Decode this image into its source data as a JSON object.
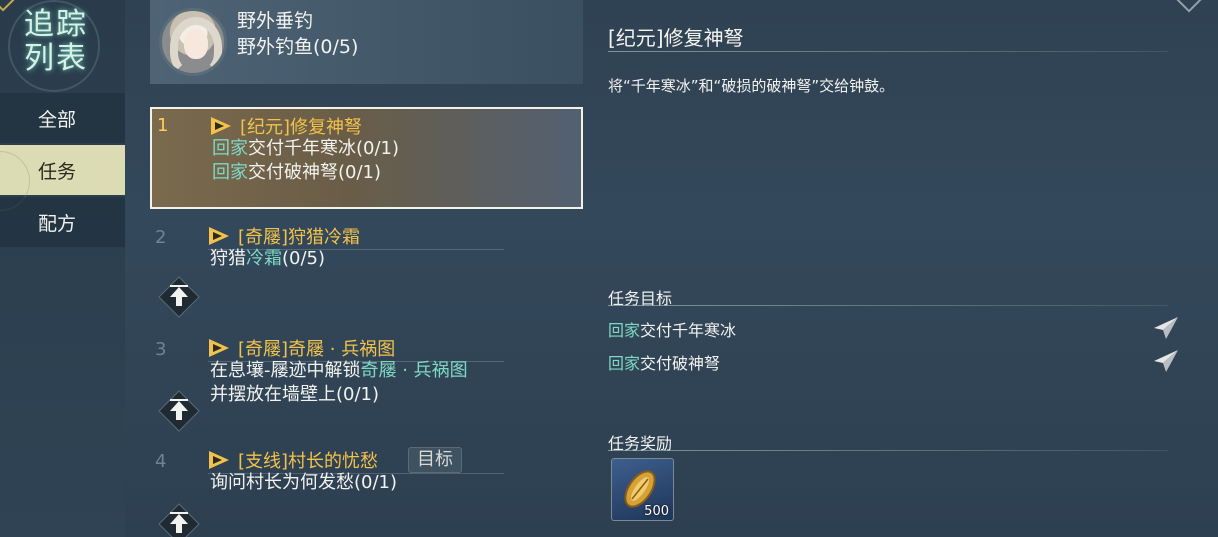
{
  "nav": {
    "title_line1": "追踪",
    "title_line2": "列表",
    "items": [
      {
        "label": "全部",
        "active": false
      },
      {
        "label": "任务",
        "active": true
      },
      {
        "label": "配方",
        "active": false
      }
    ]
  },
  "fishing": {
    "title": "野外垂钓",
    "progress": "野外钓鱼(0/5)"
  },
  "quests": [
    {
      "num": "1",
      "title": "[纪元]修复神弩",
      "lines": [
        {
          "hl": "回家",
          "text": "交付千年寒冰(0/1)"
        },
        {
          "hl": "回家",
          "text": "交付破神弩(0/1)"
        }
      ]
    },
    {
      "num": "2",
      "title": "[奇屦]狩猎冷霜",
      "line_pre": "狩猎",
      "line_hl": "冷霜",
      "line_post": "(0/5)"
    },
    {
      "num": "3",
      "title": "[奇屦]奇屦 · 兵祸图",
      "line1_pre": "在息壤-屦迹中解锁",
      "line1_hl": "奇屦 · 兵祸图",
      "line2": "并摆放在墙壁上(0/1)"
    },
    {
      "num": "4",
      "title": "[支线]村长的忧愁",
      "badge": "目标",
      "line": "询问村长为何发愁(0/1)"
    }
  ],
  "detail": {
    "title": "[纪元]修复神弩",
    "description": "将“千年寒冰”和“破损的破神弩”交给钟鼓。",
    "goals_heading": "任务目标",
    "goals": [
      {
        "hl": "回家",
        "text": "交付千年寒冰"
      },
      {
        "hl": "回家",
        "text": "交付破神弩"
      }
    ],
    "rewards_heading": "任务奖励",
    "reward_qty": "500"
  },
  "colors": {
    "accent_gold": "#f3c24a",
    "highlight_teal": "#7fd8c4",
    "nav_active_bg": "#dcdcb4"
  }
}
